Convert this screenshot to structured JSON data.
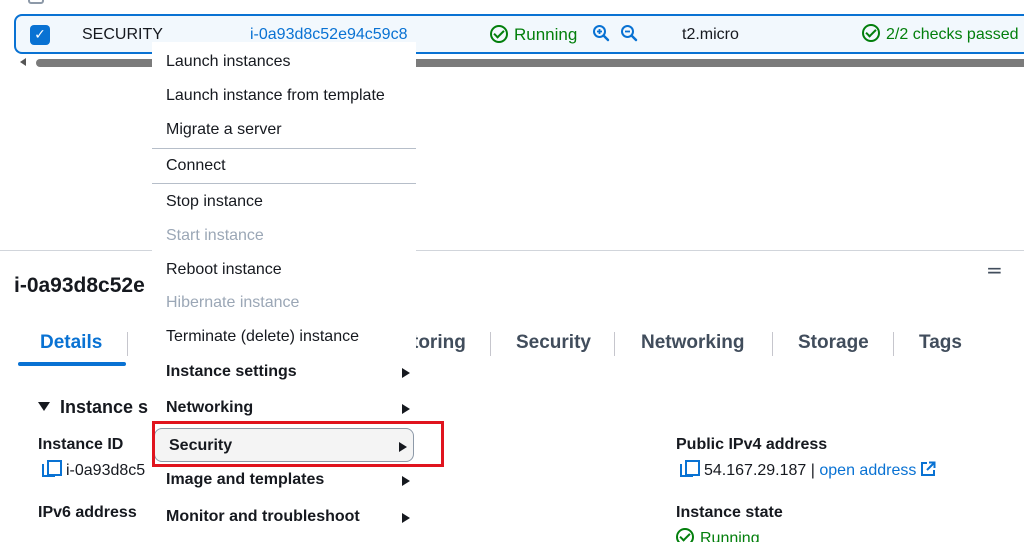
{
  "row": {
    "name": "SECURITY",
    "instance_id": "i-0a93d8c52e94c59c8",
    "state": "Running",
    "type": "t2.micro",
    "checks": "2/2 checks passed",
    "check_glyph": "✓"
  },
  "panel": {
    "menu_glyph": "=",
    "title": "i-0a93d8c52e",
    "tabs": [
      {
        "label": "Details"
      },
      {
        "label": "toring"
      },
      {
        "label": "Security"
      },
      {
        "label": "Networking"
      },
      {
        "label": "Storage"
      },
      {
        "label": "Tags"
      }
    ],
    "section": "Instance s",
    "instance_id_label": "Instance ID",
    "instance_id_value": "i-0a93d8c5",
    "ipv6_label": "IPv6 address",
    "public_ipv4_label": "Public IPv4 address",
    "public_ipv4_value": "54.167.29.187",
    "ipv4_sep": " | ",
    "open_address": "open address",
    "instance_state_label": "Instance state",
    "instance_state_value": "Running"
  },
  "menu": {
    "items": [
      {
        "label": "Launch instances"
      },
      {
        "label": "Launch instance from template"
      },
      {
        "label": "Migrate a server"
      },
      {
        "label": "Connect"
      },
      {
        "label": "Stop instance"
      },
      {
        "label": "Start instance"
      },
      {
        "label": "Reboot instance"
      },
      {
        "label": "Hibernate instance"
      },
      {
        "label": "Terminate (delete) instance"
      },
      {
        "label": "Instance settings"
      },
      {
        "label": "Networking"
      },
      {
        "label": "Security"
      },
      {
        "label": "Image and templates"
      },
      {
        "label": "Monitor and troubleshoot"
      }
    ]
  },
  "colors": {
    "accent": "#0972d3",
    "success": "#037f0c",
    "highlight_box": "#e0141e",
    "disabled": "#9ba7b6"
  },
  "icons": {
    "checkbox": "checkbox-checked-icon",
    "status": "check-circle-icon",
    "zoom_in": "zoom-in-icon",
    "zoom_out": "zoom-out-icon",
    "copy": "copy-icon",
    "external": "external-link-icon",
    "submenu": "caret-right-icon"
  }
}
